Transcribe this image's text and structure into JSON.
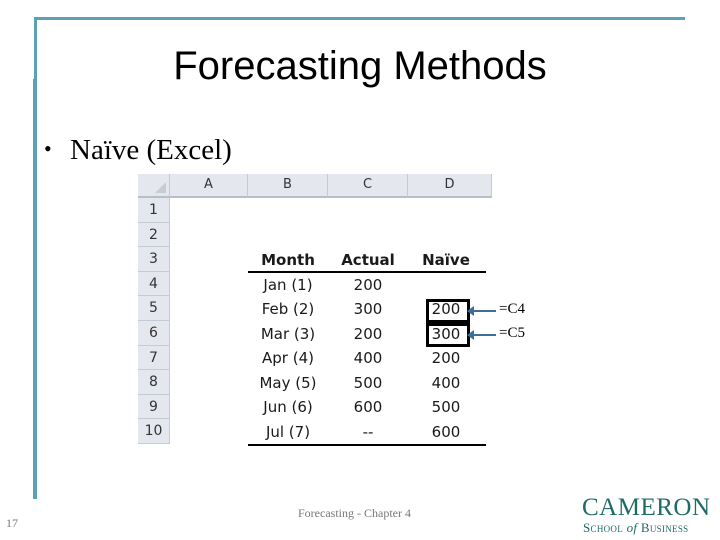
{
  "slide": {
    "title": "Forecasting Methods",
    "bullet": "Naïve (Excel)",
    "page_number": "17",
    "footer": "Forecasting - Chapter 4",
    "logo": {
      "main": "CAMERON",
      "sub_a": "School ",
      "sub_of": "of",
      "sub_b": " Business"
    },
    "accent_color": "#5ba3b2",
    "logo_color": "#1f6b66"
  },
  "spreadsheet": {
    "columns": [
      "A",
      "B",
      "C",
      "D"
    ],
    "rows": [
      "1",
      "2",
      "3",
      "4",
      "5",
      "6",
      "7",
      "8",
      "9",
      "10"
    ],
    "table_headers": {
      "month": "Month",
      "actual": "Actual",
      "naive": "Naïve"
    },
    "table_rows": [
      {
        "month": "Jan (1)",
        "actual": "200",
        "naive": ""
      },
      {
        "month": "Feb (2)",
        "actual": "300",
        "naive": "200"
      },
      {
        "month": "Mar (3)",
        "actual": "200",
        "naive": "300"
      },
      {
        "month": "Apr (4)",
        "actual": "400",
        "naive": "200"
      },
      {
        "month": "May (5)",
        "actual": "500",
        "naive": "400"
      },
      {
        "month": "Jun (6)",
        "actual": "600",
        "naive": "500"
      },
      {
        "month": "Jul (7)",
        "actual": "--",
        "naive": "600"
      }
    ],
    "annotations": [
      {
        "cell": "D5",
        "formula": "=C4"
      },
      {
        "cell": "D6",
        "formula": "=C5"
      }
    ]
  }
}
